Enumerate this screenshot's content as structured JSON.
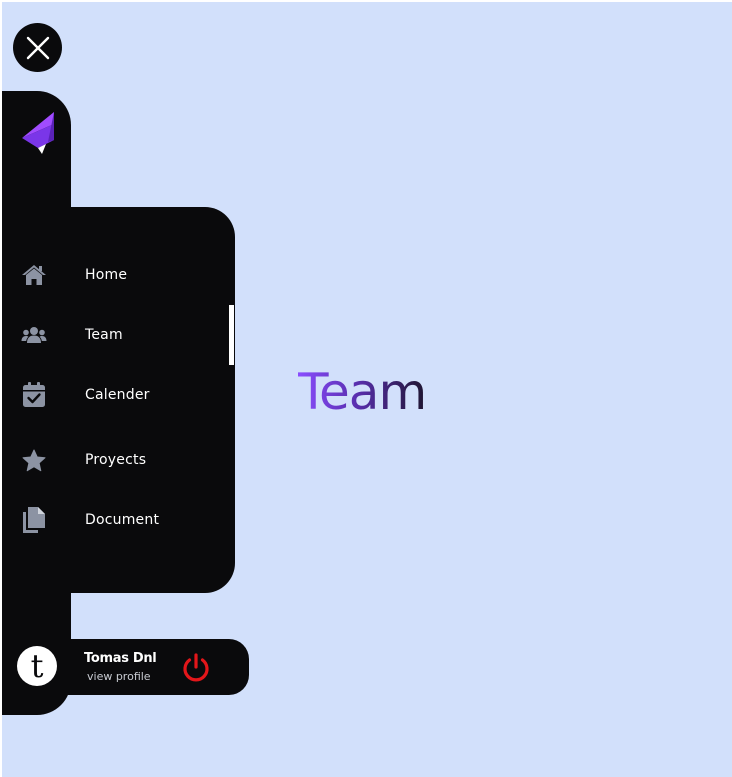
{
  "close_button": {
    "icon": "close-icon"
  },
  "logo": {
    "icon": "brand-logo-icon"
  },
  "nav": {
    "items": [
      {
        "label": "Home",
        "icon": "home-icon"
      },
      {
        "label": "Team",
        "icon": "team-icon",
        "active": true
      },
      {
        "label": "Calender",
        "icon": "calendar-check-icon"
      },
      {
        "label": "Proyects",
        "icon": "star-icon"
      },
      {
        "label": "Document",
        "icon": "documents-icon"
      }
    ]
  },
  "profile": {
    "avatar_letter": "t",
    "name": "Tomas Dnl",
    "link": "view profile",
    "logout_icon": "power-icon"
  },
  "main": {
    "title": "Team"
  },
  "colors": {
    "background": "#d2e0fb",
    "panel": "#0a0a0c",
    "icon": "#8c93a3",
    "power": "#e3161a",
    "title_gradient_start": "#8a4dff",
    "title_gradient_end": "#1e1530"
  }
}
